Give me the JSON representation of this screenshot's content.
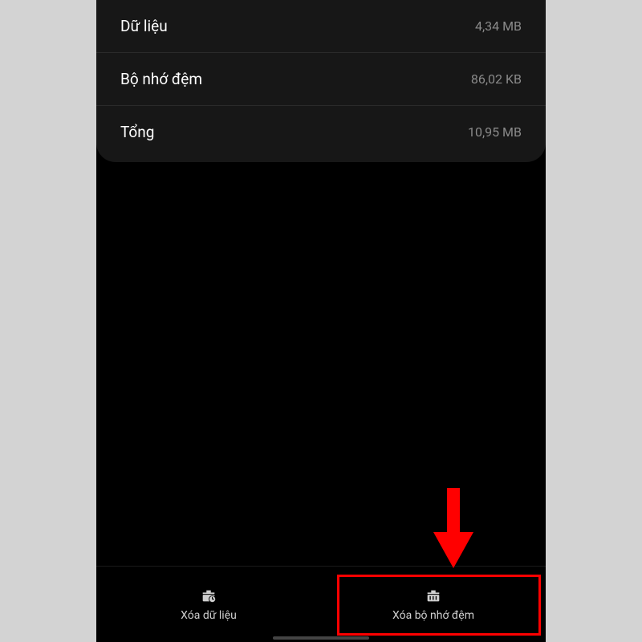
{
  "storage": {
    "rows": [
      {
        "label": "Dữ liệu",
        "value": "4,34 MB"
      },
      {
        "label": "Bộ nhớ đệm",
        "value": "86,02 KB"
      },
      {
        "label": "Tổng",
        "value": "10,95 MB"
      }
    ]
  },
  "actions": {
    "clear_data": "Xóa dữ liệu",
    "clear_cache": "Xóa bộ nhớ đệm"
  }
}
